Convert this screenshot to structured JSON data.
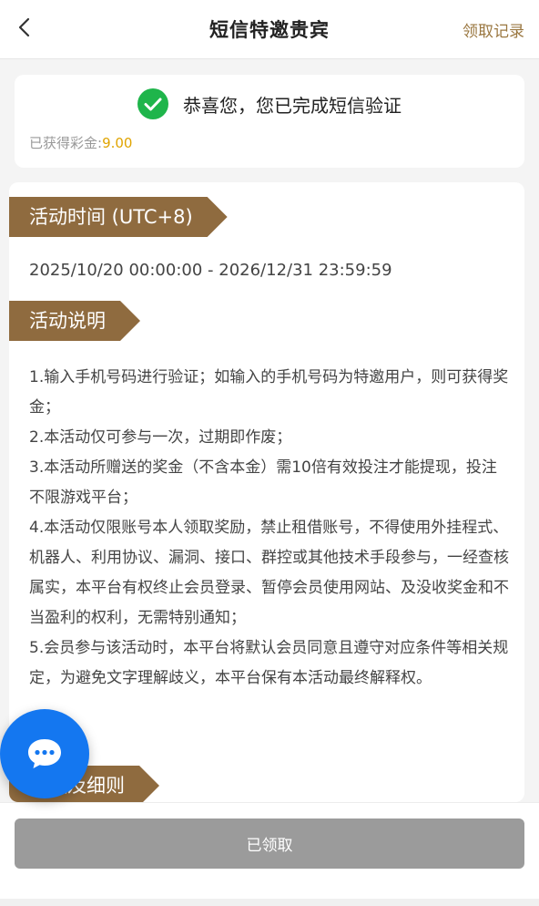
{
  "header": {
    "title": "短信特邀贵宾",
    "right_link": "领取记录"
  },
  "verify": {
    "message": "恭喜您，您已完成短信验证",
    "bonus_label": "已获得彩金:",
    "bonus_value": "9.00"
  },
  "activity": {
    "time_tag": "活动时间 (UTC+8)",
    "time_range": "2025/10/20 00:00:00 - 2026/12/31 23:59:59",
    "desc_tag": "活动说明",
    "rules": [
      "1.输入手机号码进行验证；如输入的手机号码为特邀用户，则可获得奖金；",
      "2.本活动仅可参与一次，过期即作废；",
      "3.本活动所赠送的奖金（不含本金）需10倍有效投注才能提现，投注不限游戏平台；",
      "4.本活动仅限账号本人领取奖励，禁止租借账号，不得使用外挂程式、机器人、利用协议、漏洞、接口、群控或其他技术手段参与，一经查核属实，本平台有权终止会员登录、暂停会员使用网站、及没收奖金和不当盈利的权利，无需特别通知；",
      "5.会员参与该活动时，本平台将默认会员同意且遵守对应条件等相关规定，为避免文字理解歧义，本平台保有本活动最终解释权。"
    ],
    "terms_tag": "条款及细则"
  },
  "footer": {
    "claim_button": "已领取"
  },
  "colors": {
    "accent_brown": "#8f6b3f",
    "link_gold": "#9a7740",
    "bonus_yellow": "#e0a400",
    "check_green": "#1fb54b",
    "chat_blue": "#1477f0",
    "disabled_gray": "#9b9b9b"
  }
}
